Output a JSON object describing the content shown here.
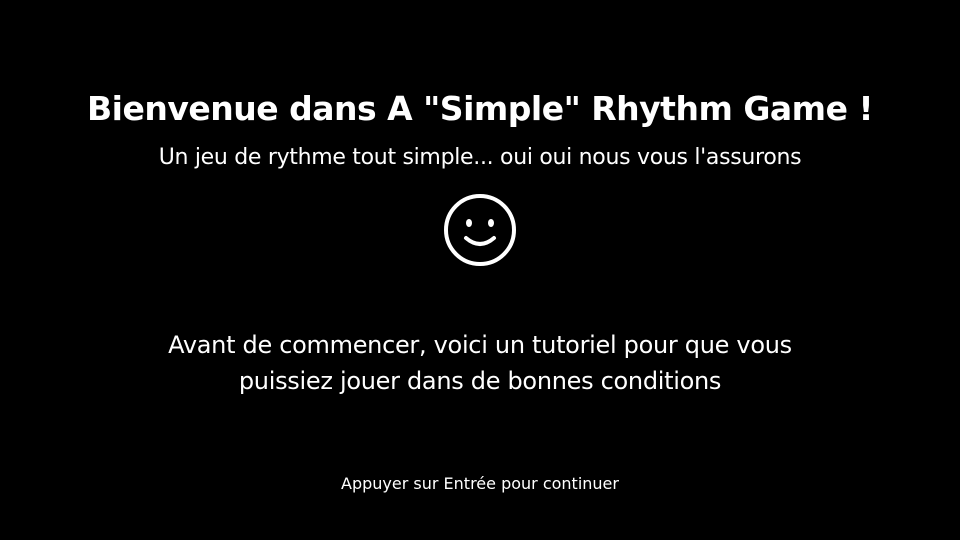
{
  "title": "Bienvenue dans A \"Simple\" Rhythm Game !",
  "subtitle": "Un jeu de rythme tout simple... oui oui nous vous l'assurons",
  "icon": "smiley-face-icon",
  "tutorial": {
    "line1": "Avant de commencer, voici un tutoriel pour que vous",
    "line2": "puissiez jouer dans de bonnes conditions"
  },
  "prompt": "Appuyer sur Entrée pour continuer",
  "colors": {
    "background": "#000000",
    "text": "#ffffff"
  }
}
